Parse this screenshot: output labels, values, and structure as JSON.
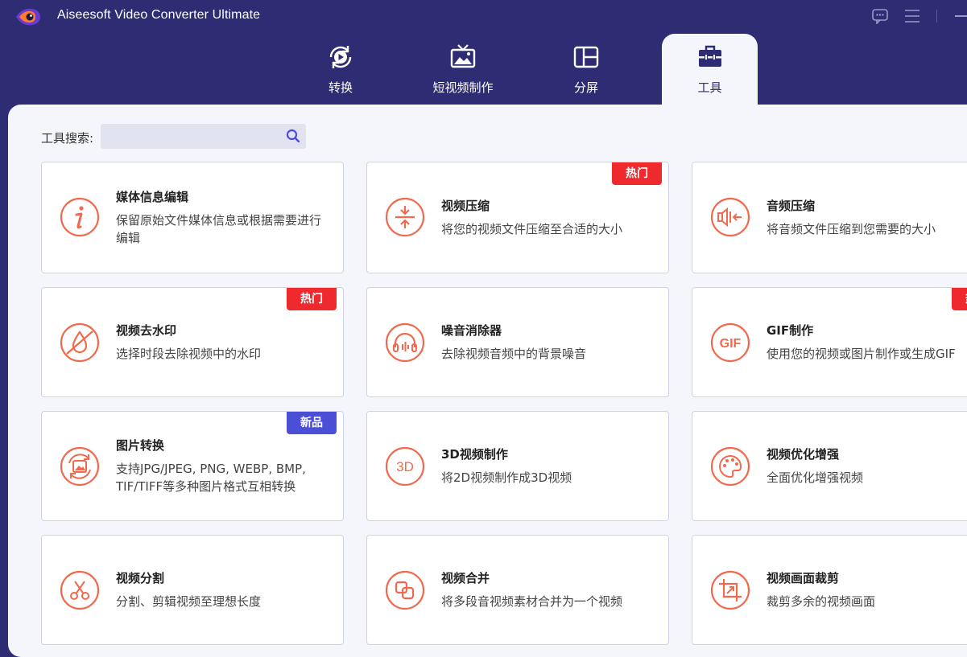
{
  "app": {
    "title": "Aiseesoft Video Converter Ultimate",
    "icons": {
      "logo": "aiseesoft-logo",
      "feedback": "chat-icon",
      "menu": "hamburger-icon",
      "minimize": "minimize-icon"
    }
  },
  "nav": {
    "tabs": [
      {
        "label": "转换",
        "icon": "convert-icon",
        "active": false
      },
      {
        "label": "短视频制作",
        "icon": "mv-icon",
        "active": false
      },
      {
        "label": "分屏",
        "icon": "collage-icon",
        "active": false
      },
      {
        "label": "工具",
        "icon": "toolbox-icon",
        "active": true
      }
    ]
  },
  "search": {
    "label": "工具搜索:",
    "value": "",
    "placeholder": "",
    "icon": "search-icon"
  },
  "colors": {
    "accent": "#f06a4e",
    "header_bg": "#2e2c73",
    "content_bg": "#f5f6fb",
    "badge_hot": "#ef2a2f",
    "badge_new": "#4b4fd6"
  },
  "tools": [
    {
      "title": "媒体信息编辑",
      "desc": "保留原始文件媒体信息或根据需要进行编辑",
      "icon": "info-icon",
      "badge": ""
    },
    {
      "title": "视频压缩",
      "desc": "将您的视频文件压缩至合适的大小",
      "icon": "compress-icon",
      "badge": "热门"
    },
    {
      "title": "音频压缩",
      "desc": "将音频文件压缩到您需要的大小",
      "icon": "audio-compress-icon",
      "badge": ""
    },
    {
      "title": "视频去水印",
      "desc": "选择时段去除视频中的水印",
      "icon": "watermark-remove-icon",
      "badge": "热门"
    },
    {
      "title": "噪音消除器",
      "desc": "去除视频音频中的背景噪音",
      "icon": "noise-remove-icon",
      "badge": ""
    },
    {
      "title": "GIF制作",
      "desc": "使用您的视频或图片制作或生成GIF",
      "icon": "gif-icon",
      "badge": "热门"
    },
    {
      "title": "图片转换",
      "desc": "支持JPG/JPEG, PNG, WEBP, BMP, TIF/TIFF等多种图片格式互相转换",
      "icon": "image-convert-icon",
      "badge": "新品"
    },
    {
      "title": "3D视频制作",
      "desc": "将2D视频制作成3D视频",
      "icon": "3d-icon",
      "badge": ""
    },
    {
      "title": "视频优化增强",
      "desc": "全面优化增强视频",
      "icon": "palette-icon",
      "badge": ""
    },
    {
      "title": "视频分割",
      "desc": "分割、剪辑视频至理想长度",
      "icon": "scissors-icon",
      "badge": ""
    },
    {
      "title": "视频合并",
      "desc": "将多段音视频素材合并为一个视频",
      "icon": "merge-icon",
      "badge": ""
    },
    {
      "title": "视频画面裁剪",
      "desc": "裁剪多余的视频画面",
      "icon": "crop-icon",
      "badge": ""
    }
  ]
}
